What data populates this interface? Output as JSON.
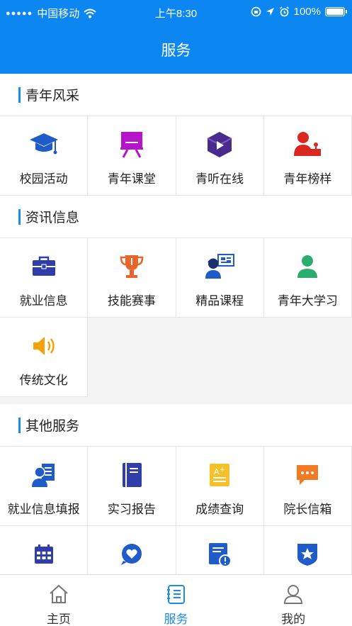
{
  "status_bar": {
    "carrier": "中国移动",
    "time": "上午8:30",
    "battery": "100%"
  },
  "nav": {
    "title": "服务"
  },
  "sections": [
    {
      "title": "青年风采",
      "items": [
        {
          "label": "校园活动",
          "icon": "graduation-cap-icon"
        },
        {
          "label": "青年课堂",
          "icon": "easel-board-icon"
        },
        {
          "label": "青听在线",
          "icon": "play-cube-icon"
        },
        {
          "label": "青年榜样",
          "icon": "person-podium-icon"
        }
      ]
    },
    {
      "title": "资讯信息",
      "items": [
        {
          "label": "就业信息",
          "icon": "briefcase-icon"
        },
        {
          "label": "技能赛事",
          "icon": "trophy-icon"
        },
        {
          "label": "精品课程",
          "icon": "online-course-icon"
        },
        {
          "label": "青年大学习",
          "icon": "person-icon"
        },
        {
          "label": "传统文化",
          "icon": "speaker-icon"
        }
      ]
    },
    {
      "title": "其他服务",
      "items": [
        {
          "label": "就业信息填报",
          "icon": "employment-form-icon"
        },
        {
          "label": "实习报告",
          "icon": "notebook-icon"
        },
        {
          "label": "成绩查询",
          "icon": "grade-icon"
        },
        {
          "label": "院长信箱",
          "icon": "message-icon"
        },
        {
          "label": "",
          "icon": "calendar-icon"
        },
        {
          "label": "",
          "icon": "heart-chat-icon"
        },
        {
          "label": "",
          "icon": "alert-document-icon"
        },
        {
          "label": "",
          "icon": "star-badge-icon"
        }
      ]
    }
  ],
  "tabs": [
    {
      "label": "主页",
      "icon": "home-icon"
    },
    {
      "label": "服务",
      "icon": "service-list-icon"
    },
    {
      "label": "我的",
      "icon": "user-icon"
    }
  ],
  "colors": {
    "primary": "#0c86f0",
    "active_tab": "#1a8cf0"
  }
}
